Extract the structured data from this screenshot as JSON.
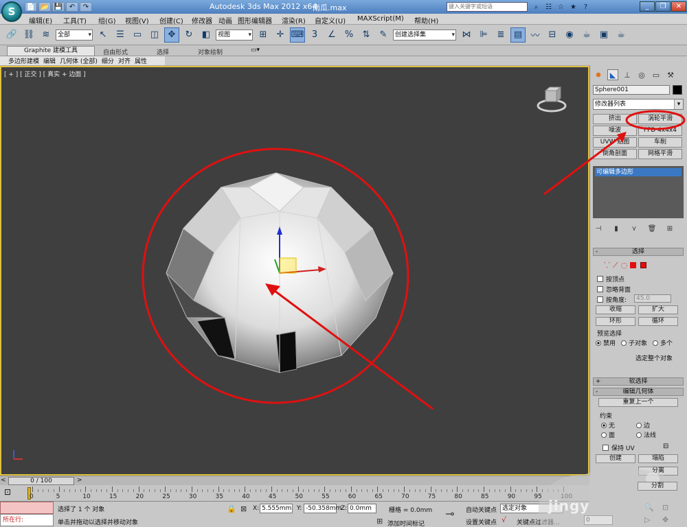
{
  "titlebar": {
    "quick_access": [
      "📄",
      "📂",
      "💾",
      "↶",
      "↷"
    ],
    "app_title": "Autodesk 3ds Max  2012 x64",
    "file_name": "南瓜.max",
    "search_placeholder": "键入关键字或短语",
    "window_controls": [
      "_",
      "❐",
      "✕"
    ]
  },
  "menu": {
    "items": [
      "编辑(E)",
      "工具(T)",
      "组(G)",
      "视图(V)",
      "创建(C)",
      "修改器",
      "动画",
      "图形编辑器",
      "渲染(R)",
      "自定义(U)",
      "MAXScript(M)",
      "帮助(H)"
    ]
  },
  "toolbar": {
    "selection_filter": "全部",
    "ref_coord": "视图",
    "named_selection": "创建选择集"
  },
  "ribbon": {
    "tabs": [
      "Graphite 建模工具",
      "自由形式",
      "选择",
      "对象绘制"
    ],
    "sub_items": [
      "多边形建模",
      "编辑",
      "几何体 (全部)",
      "细分",
      "对齐",
      "属性"
    ]
  },
  "viewport": {
    "label": "[ + ] [ 正交 ] [ 真实 + 边面 ]"
  },
  "command_panel": {
    "object_name": "Sphere001",
    "object_color": "#000000",
    "modifier_list": "修改器列表",
    "modifier_buttons": [
      "挤出",
      "涡轮平滑",
      "噪波",
      "FFD 4x4x4",
      "UVW 贴图",
      "车削",
      "倒角剖面",
      "网格平滑"
    ],
    "stack_item": "可编辑多边形",
    "selection": {
      "title": "选择",
      "by_vertex": "按顶点",
      "ignore_backfacing": "忽略背面",
      "by_angle": "按角度:",
      "angle_value": "45.0",
      "shrink": "收缩",
      "grow": "扩大",
      "ring": "环形",
      "loop": "循环",
      "preview_title": "预览选择",
      "preview_options": [
        "禁用",
        "子对象",
        "多个"
      ],
      "status": "选定整个对象"
    },
    "soft_selection": "软选择",
    "edit_geometry": "编辑几何体",
    "repeat_last": "重复上一个",
    "constraints": {
      "title": "约束",
      "options": [
        "无",
        "边",
        "面",
        "法线"
      ]
    },
    "preserve_uv": "保持 UV",
    "create": "创建",
    "collapse": "塌陷",
    "detach": "分离",
    "split": "分割"
  },
  "timeslider": {
    "frame": "0 / 100"
  },
  "trackbar": {
    "labels": [
      "0",
      "5",
      "10",
      "15",
      "20",
      "25",
      "30",
      "35",
      "40",
      "45",
      "50",
      "55",
      "60",
      "65",
      "70",
      "75",
      "80",
      "85",
      "90",
      "95",
      "100"
    ]
  },
  "status": {
    "script_label": "",
    "script_now": "所在行:",
    "line1": "选择了 1 个 对象",
    "line2": "单击并拖动以选择并移动对象",
    "x_label": "X:",
    "x_value": "5.555mm",
    "y_label": "Y:",
    "y_value": "-50.358mm",
    "z_label": "Z:",
    "z_value": "0.0mm",
    "grid": "栅格 = 0.0mm",
    "add_time_tag": "添加时间标记",
    "auto_key": "自动关键点",
    "selected_object": "选定对象",
    "set_key": "设置关键点",
    "key_filters": "关键点过滤器...",
    "frame_field": "0"
  },
  "watermark": "jingy"
}
